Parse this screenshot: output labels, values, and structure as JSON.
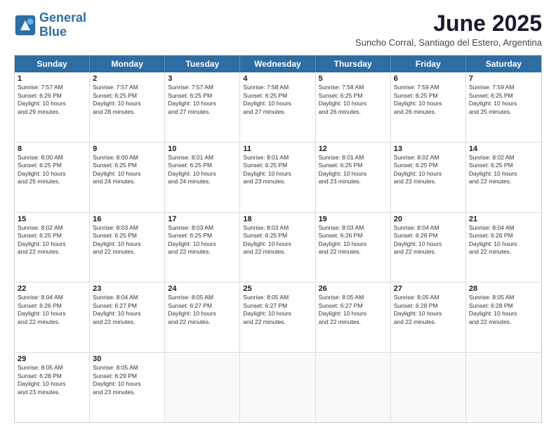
{
  "logo": {
    "line1": "General",
    "line2": "Blue"
  },
  "title": "June 2025",
  "subtitle": "Suncho Corral, Santiago del Estero, Argentina",
  "header_days": [
    "Sunday",
    "Monday",
    "Tuesday",
    "Wednesday",
    "Thursday",
    "Friday",
    "Saturday"
  ],
  "weeks": [
    [
      {
        "day": "1",
        "text": "Sunrise: 7:57 AM\nSunset: 6:26 PM\nDaylight: 10 hours\nand 29 minutes."
      },
      {
        "day": "2",
        "text": "Sunrise: 7:57 AM\nSunset: 6:25 PM\nDaylight: 10 hours\nand 28 minutes."
      },
      {
        "day": "3",
        "text": "Sunrise: 7:57 AM\nSunset: 6:25 PM\nDaylight: 10 hours\nand 27 minutes."
      },
      {
        "day": "4",
        "text": "Sunrise: 7:58 AM\nSunset: 6:25 PM\nDaylight: 10 hours\nand 27 minutes."
      },
      {
        "day": "5",
        "text": "Sunrise: 7:58 AM\nSunset: 6:25 PM\nDaylight: 10 hours\nand 26 minutes."
      },
      {
        "day": "6",
        "text": "Sunrise: 7:59 AM\nSunset: 6:25 PM\nDaylight: 10 hours\nand 26 minutes."
      },
      {
        "day": "7",
        "text": "Sunrise: 7:59 AM\nSunset: 6:25 PM\nDaylight: 10 hours\nand 25 minutes."
      }
    ],
    [
      {
        "day": "8",
        "text": "Sunrise: 8:00 AM\nSunset: 6:25 PM\nDaylight: 10 hours\nand 25 minutes."
      },
      {
        "day": "9",
        "text": "Sunrise: 8:00 AM\nSunset: 6:25 PM\nDaylight: 10 hours\nand 24 minutes."
      },
      {
        "day": "10",
        "text": "Sunrise: 8:01 AM\nSunset: 6:25 PM\nDaylight: 10 hours\nand 24 minutes."
      },
      {
        "day": "11",
        "text": "Sunrise: 8:01 AM\nSunset: 6:25 PM\nDaylight: 10 hours\nand 23 minutes."
      },
      {
        "day": "12",
        "text": "Sunrise: 8:01 AM\nSunset: 6:25 PM\nDaylight: 10 hours\nand 23 minutes."
      },
      {
        "day": "13",
        "text": "Sunrise: 8:02 AM\nSunset: 6:25 PM\nDaylight: 10 hours\nand 23 minutes."
      },
      {
        "day": "14",
        "text": "Sunrise: 8:02 AM\nSunset: 6:25 PM\nDaylight: 10 hours\nand 22 minutes."
      }
    ],
    [
      {
        "day": "15",
        "text": "Sunrise: 8:02 AM\nSunset: 6:25 PM\nDaylight: 10 hours\nand 22 minutes."
      },
      {
        "day": "16",
        "text": "Sunrise: 8:03 AM\nSunset: 6:25 PM\nDaylight: 10 hours\nand 22 minutes."
      },
      {
        "day": "17",
        "text": "Sunrise: 8:03 AM\nSunset: 6:25 PM\nDaylight: 10 hours\nand 22 minutes."
      },
      {
        "day": "18",
        "text": "Sunrise: 8:03 AM\nSunset: 6:25 PM\nDaylight: 10 hours\nand 22 minutes."
      },
      {
        "day": "19",
        "text": "Sunrise: 8:03 AM\nSunset: 6:26 PM\nDaylight: 10 hours\nand 22 minutes."
      },
      {
        "day": "20",
        "text": "Sunrise: 8:04 AM\nSunset: 6:26 PM\nDaylight: 10 hours\nand 22 minutes."
      },
      {
        "day": "21",
        "text": "Sunrise: 8:04 AM\nSunset: 6:26 PM\nDaylight: 10 hours\nand 22 minutes."
      }
    ],
    [
      {
        "day": "22",
        "text": "Sunrise: 8:04 AM\nSunset: 6:26 PM\nDaylight: 10 hours\nand 22 minutes."
      },
      {
        "day": "23",
        "text": "Sunrise: 8:04 AM\nSunset: 6:27 PM\nDaylight: 10 hours\nand 22 minutes."
      },
      {
        "day": "24",
        "text": "Sunrise: 8:05 AM\nSunset: 6:27 PM\nDaylight: 10 hours\nand 22 minutes."
      },
      {
        "day": "25",
        "text": "Sunrise: 8:05 AM\nSunset: 6:27 PM\nDaylight: 10 hours\nand 22 minutes."
      },
      {
        "day": "26",
        "text": "Sunrise: 8:05 AM\nSunset: 6:27 PM\nDaylight: 10 hours\nand 22 minutes."
      },
      {
        "day": "27",
        "text": "Sunrise: 8:05 AM\nSunset: 6:28 PM\nDaylight: 10 hours\nand 22 minutes."
      },
      {
        "day": "28",
        "text": "Sunrise: 8:05 AM\nSunset: 6:28 PM\nDaylight: 10 hours\nand 22 minutes."
      }
    ],
    [
      {
        "day": "29",
        "text": "Sunrise: 8:05 AM\nSunset: 6:28 PM\nDaylight: 10 hours\nand 23 minutes."
      },
      {
        "day": "30",
        "text": "Sunrise: 8:05 AM\nSunset: 6:29 PM\nDaylight: 10 hours\nand 23 minutes."
      },
      {
        "day": "",
        "text": ""
      },
      {
        "day": "",
        "text": ""
      },
      {
        "day": "",
        "text": ""
      },
      {
        "day": "",
        "text": ""
      },
      {
        "day": "",
        "text": ""
      }
    ]
  ]
}
